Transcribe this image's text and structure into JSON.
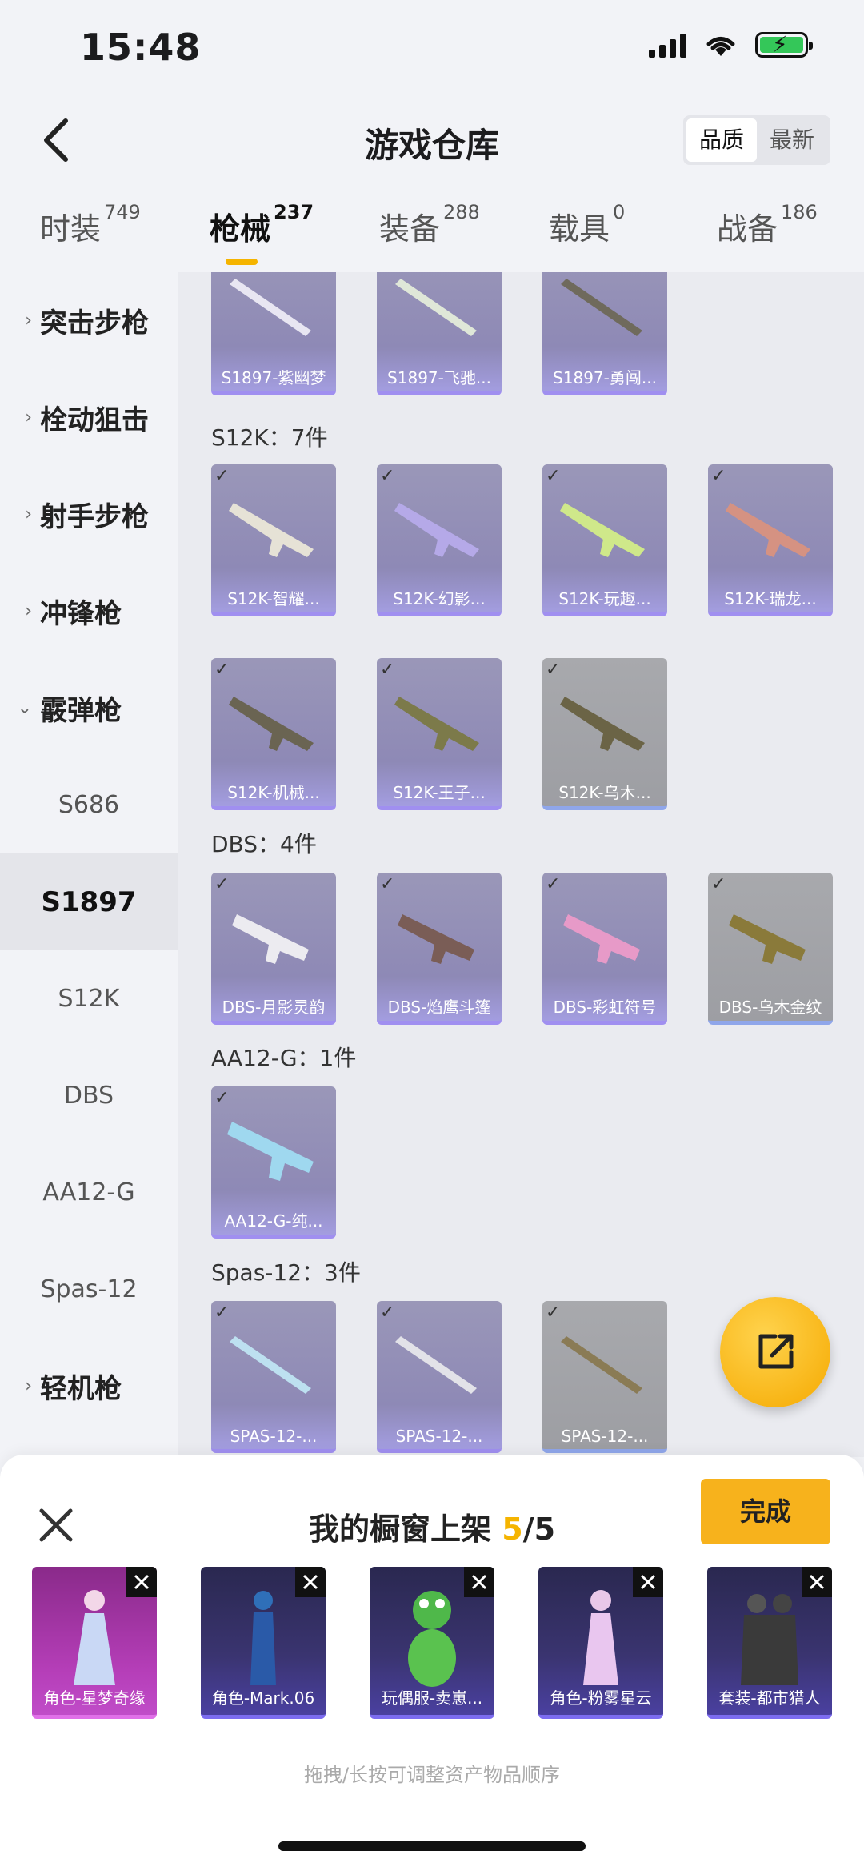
{
  "status": {
    "time": "15:48"
  },
  "header": {
    "title": "游戏仓库",
    "sort_options": [
      "品质",
      "最新"
    ],
    "active_sort": 0
  },
  "tabs": [
    {
      "label": "时装",
      "count": "749"
    },
    {
      "label": "枪械",
      "count": "237",
      "active": true
    },
    {
      "label": "装备",
      "count": "288"
    },
    {
      "label": "载具",
      "count": "0"
    },
    {
      "label": "战备",
      "count": "186"
    }
  ],
  "sidebar": {
    "categories": [
      {
        "label": "突击步枪",
        "chev": "›"
      },
      {
        "label": "栓动狙击",
        "chev": "›"
      },
      {
        "label": "射手步枪",
        "chev": "›"
      },
      {
        "label": "冲锋枪",
        "chev": "›"
      },
      {
        "label": "霰弹枪",
        "chev": "⌄"
      }
    ],
    "subs": [
      "S686",
      "S1897",
      "S12K",
      "DBS",
      "AA12-G",
      "Spas-12"
    ],
    "active_sub": "S1897",
    "last_category": {
      "label": "轻机枪",
      "chev": "›"
    }
  },
  "groups": {
    "s1897_items": [
      "S1897-紫幽梦",
      "S1897-飞驰...",
      "S1897-勇闯..."
    ],
    "s12k_title": "S12K：7件",
    "s12k_items": [
      "S12K-智耀...",
      "S12K-幻影...",
      "S12K-玩趣...",
      "S12K-瑞龙...",
      "S12K-机械...",
      "S12K-王子...",
      "S12K-乌木..."
    ],
    "dbs_title": "DBS：4件",
    "dbs_items": [
      "DBS-月影灵韵",
      "DBS-焰鹰斗篷",
      "DBS-彩虹符号",
      "DBS-乌木金纹"
    ],
    "aa12_title": "AA12-G：1件",
    "aa12_items": [
      "AA12-G-纯..."
    ],
    "spas_title": "Spas-12：3件",
    "spas_items": [
      "SPAS-12-...",
      "SPAS-12-...",
      "SPAS-12-..."
    ]
  },
  "sheet": {
    "title": "我的橱窗上架",
    "count_current": "5",
    "count_total": "/5",
    "done_label": "完成",
    "items": [
      "角色-星梦奇缘",
      "角色-Mark.06",
      "玩偶服-卖崽...",
      "角色-粉雾星云",
      "套装-都市猎人"
    ],
    "hint": "拖拽/长按可调整资产物品顺序"
  },
  "colors": {
    "accent": "#f5b400",
    "card_purple": "#8e89b6",
    "card_gray": "#9d9ea3"
  }
}
